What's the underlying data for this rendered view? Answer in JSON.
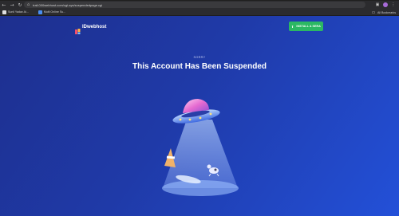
{
  "browser": {
    "url": "trail.000webhost.com/cgi-sys/suspendedpage.cgi",
    "bookmarks": [
      {
        "label": "Sunil Yadav Ai...",
        "color": "#e0e0e0"
      },
      {
        "label": "Multi Online Su...",
        "color": "#4a8ef0"
      }
    ],
    "all_bookmarks_label": "All Bookmarks"
  },
  "header": {
    "logo_text": "IDwebhost",
    "install_button_label": "INSTALL A SERA"
  },
  "main": {
    "eyebrow": "SORRY",
    "title": "This Account Has Been Suspended"
  },
  "icons": {
    "back": "arrow-left",
    "forward": "arrow-right",
    "reload": "reload",
    "lock": "lock",
    "extensions": "puzzle",
    "folder": "folder",
    "illustration": "ufo-abducting-objects"
  }
}
